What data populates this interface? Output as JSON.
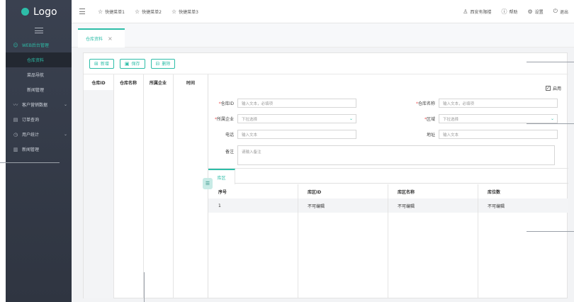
{
  "logo": {
    "text": "Logo"
  },
  "sidebar": {
    "group": {
      "label": "WEB后台管理",
      "icon": "people-icon"
    },
    "sub_items": [
      {
        "label": "仓库资料",
        "active": true
      },
      {
        "label": "菜品导航",
        "active": false
      },
      {
        "label": "新闻管理",
        "active": false
      }
    ],
    "items": [
      {
        "label": "客户营销数据",
        "icon": "chart-line-icon",
        "has_chevron": true
      },
      {
        "label": "订单查询",
        "icon": "receipt-icon",
        "has_chevron": false
      },
      {
        "label": "用户统计",
        "icon": "clock-icon",
        "has_chevron": true
      },
      {
        "label": "新闻管理",
        "icon": "book-icon",
        "has_chevron": false
      }
    ]
  },
  "topbar": {
    "quick_menus": [
      "快捷菜单1",
      "快捷菜单2",
      "快捷菜单3"
    ],
    "user": "西安有限楼",
    "help": "帮助",
    "settings": "设置",
    "logout": "退出"
  },
  "tabs": [
    {
      "label": "仓库资料",
      "closable": true
    }
  ],
  "toolbar": {
    "add": "新增",
    "save": "保存",
    "delete": "删除"
  },
  "list_table": {
    "headers": [
      "仓库ID",
      "仓库名称",
      "所属企业",
      "时间"
    ]
  },
  "form": {
    "enable_label": "启用",
    "enable_checked": true,
    "fields": {
      "warehouse_id": {
        "label": "仓库ID",
        "required": true,
        "placeholder": "输入文本，必填项"
      },
      "warehouse_name": {
        "label": "仓库名称",
        "required": true,
        "placeholder": "输入文本，必填项"
      },
      "company": {
        "label": "所属企业",
        "required": true,
        "placeholder": "下拉选择"
      },
      "region": {
        "label": "区域",
        "required": true,
        "placeholder": "下拉选择"
      },
      "phone": {
        "label": "电话",
        "required": false,
        "placeholder": "输入文本"
      },
      "address": {
        "label": "地址",
        "required": false,
        "placeholder": "输入文本"
      },
      "remark": {
        "label": "备注",
        "required": false,
        "placeholder": "请输入备注"
      }
    }
  },
  "sub_tab": {
    "label": "库区"
  },
  "zone_table": {
    "headers": [
      "序号",
      "库区ID",
      "库区名称",
      "库位数"
    ],
    "rows": [
      [
        "1",
        "不可编辑",
        "不可编辑",
        "不可编辑"
      ]
    ]
  },
  "icons": {
    "handle": "list-icon"
  },
  "colors": {
    "accent": "#2dbda8",
    "sidebar_bg": "#343a46"
  }
}
